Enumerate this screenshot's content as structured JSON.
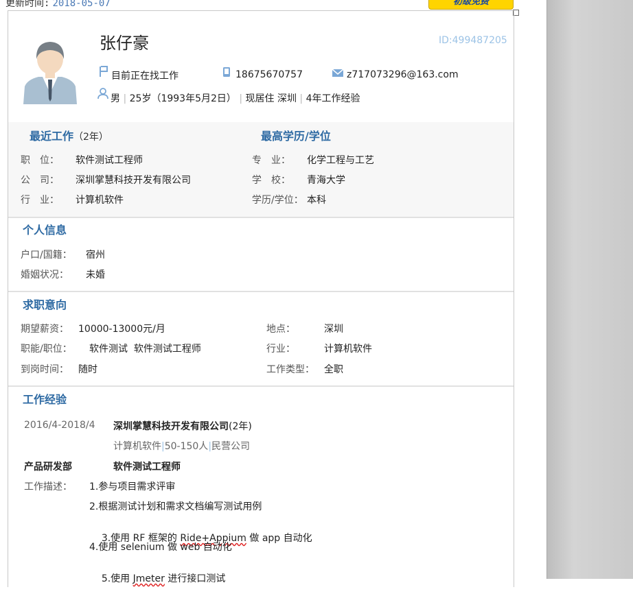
{
  "top": {
    "update_label": "更新时间:",
    "update_date": "2018-05-07",
    "badge": "初级免费"
  },
  "profile": {
    "name": "张仔豪",
    "id_text": "ID:499487205",
    "status": "目前正在找工作",
    "phone": "18675670757",
    "email": "z717073296@163.com",
    "gender": "男",
    "age": "25岁（1993年5月2日）",
    "residence": "现居住 深圳",
    "experience": "4年工作经验"
  },
  "recent": {
    "title": "最近工作",
    "years": "（2年）",
    "position_label": "职　位：",
    "position": "软件测试工程师",
    "company_label": "公　司：",
    "company": "深圳掌慧科技开发有限公司",
    "industry_label": "行　业：",
    "industry": "计算机软件"
  },
  "education": {
    "title": "最高学历/学位",
    "major_label": "专　业：",
    "major": "化学工程与工艺",
    "school_label": "学　校：",
    "school": "青海大学",
    "degree_label": "学历/学位：",
    "degree": "本科"
  },
  "personal": {
    "title": "个人信息",
    "hukou_label": "户口/国籍：",
    "hukou": "宿州",
    "marital_label": "婚姻状况：",
    "marital": "未婚"
  },
  "intent": {
    "title": "求职意向",
    "salary_label": "期望薪资：",
    "salary": "10000-13000元/月",
    "location_label": "地点：",
    "location": "深圳",
    "function_label": "职能/职位：",
    "function": "软件测试  软件测试工程师",
    "industry_label": "行业：",
    "industry": "计算机软件",
    "start_label": "到岗时间：",
    "start": "随时",
    "type_label": "工作类型：",
    "type": "全职"
  },
  "work": {
    "title": "工作经验",
    "period": "2016/4-2018/4",
    "company": "深圳掌慧科技开发有限公司",
    "company_years": "(2年)",
    "meta_industry": "计算机软件",
    "meta_size": "50-150人",
    "meta_type": "民营公司",
    "department": "产品研发部",
    "role": "软件测试工程师",
    "desc_label": "工作描述：",
    "desc": [
      "1.参与项目需求评审",
      "2.根据测试计划和需求文档编写测试用例",
      "3.使用 RF 框架的 ",
      "Ride+Appium",
      " 做 app 自动化",
      "4.使用 selenium 做 web 自动化",
      "5.使用 ",
      "Jmeter",
      " 进行接口测试"
    ]
  },
  "colors": {
    "accent": "#2e6aa3",
    "id_blue": "#9cc3e6",
    "link_blue": "#4a79b5"
  },
  "icons": [
    "flag-icon",
    "phone-icon",
    "mail-icon",
    "person-icon"
  ]
}
